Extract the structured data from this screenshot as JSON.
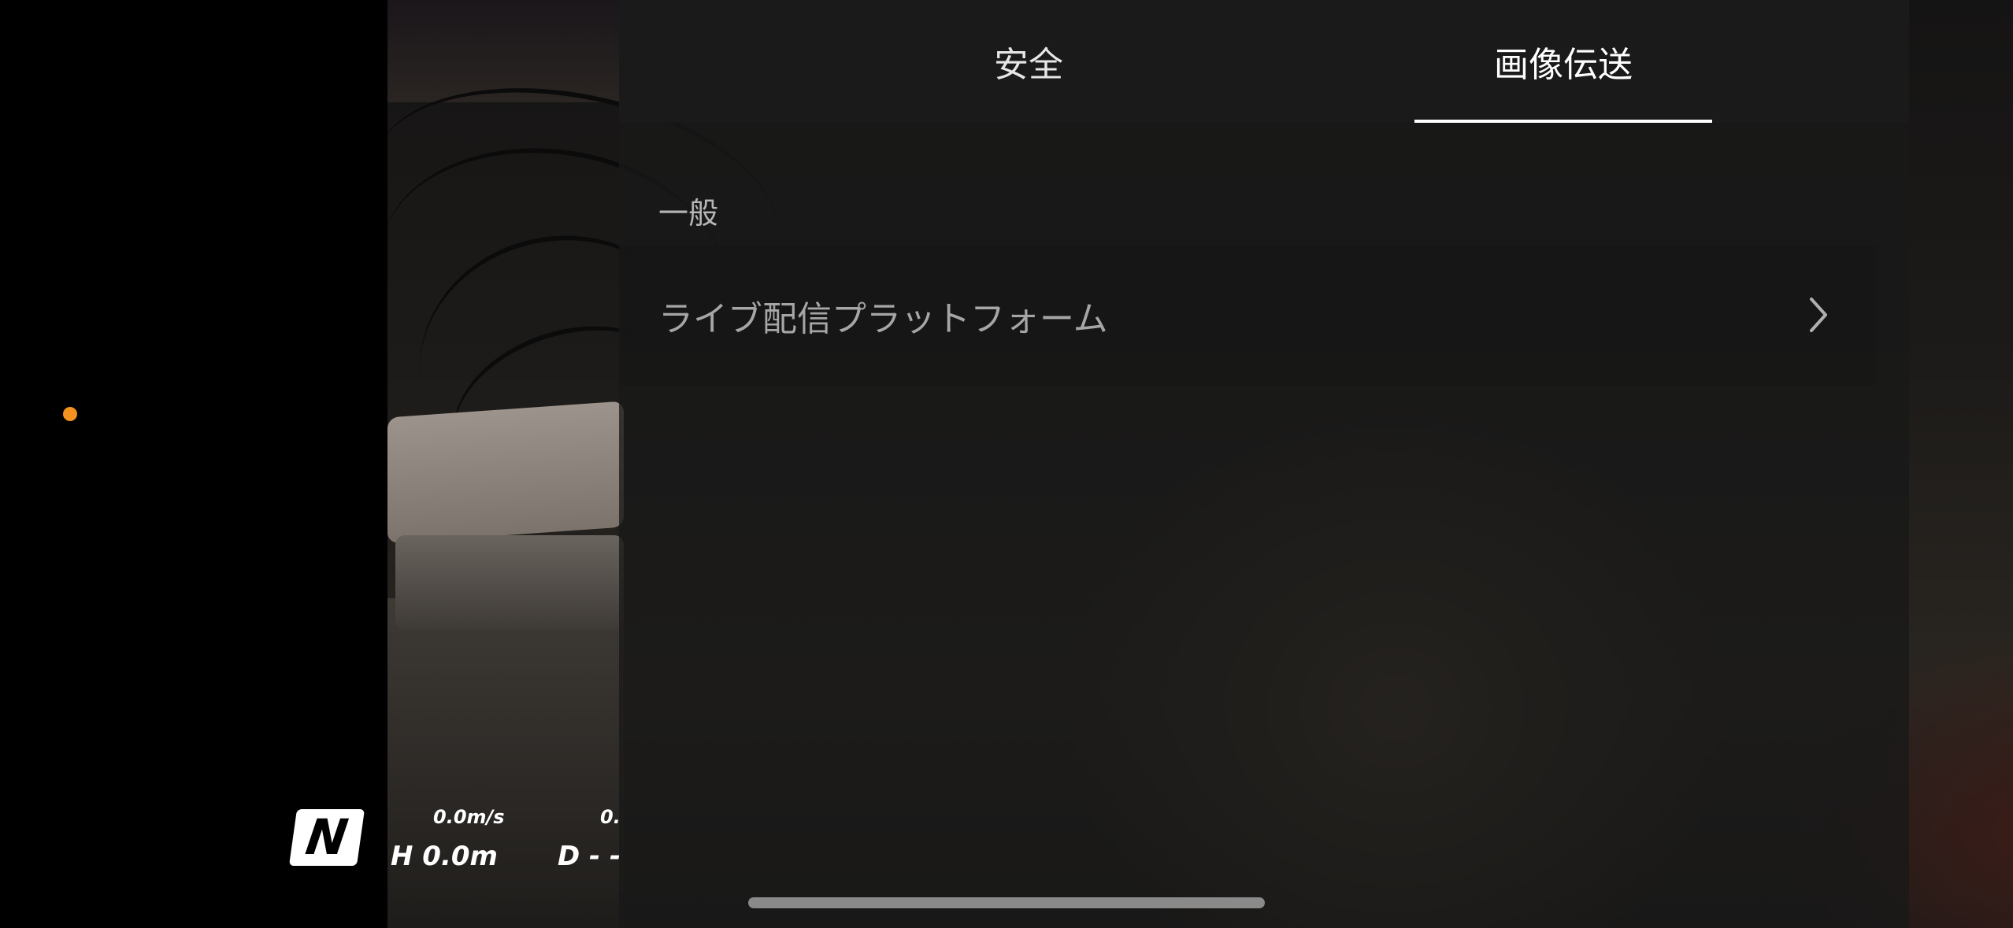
{
  "hud": {
    "flight_mode": "N",
    "vertical_speed": "0.0m/s",
    "horizontal_speed_partial": "0.",
    "height": "H 0.0m",
    "distance_partial": "D - -",
    "status_dot_color": "#f5911e"
  },
  "settings": {
    "tabs": [
      {
        "label": "安全",
        "active": false
      },
      {
        "label": "画像伝送",
        "active": true
      }
    ],
    "section_label": "一般",
    "rows": [
      {
        "label": "ライブ配信プラットフォーム",
        "icon": "chevron-right-icon"
      }
    ]
  },
  "colors": {
    "accent_orange": "#f5911e",
    "panel_bg": "#1a1a1a",
    "active_tab_indicator": "#ffffff"
  }
}
